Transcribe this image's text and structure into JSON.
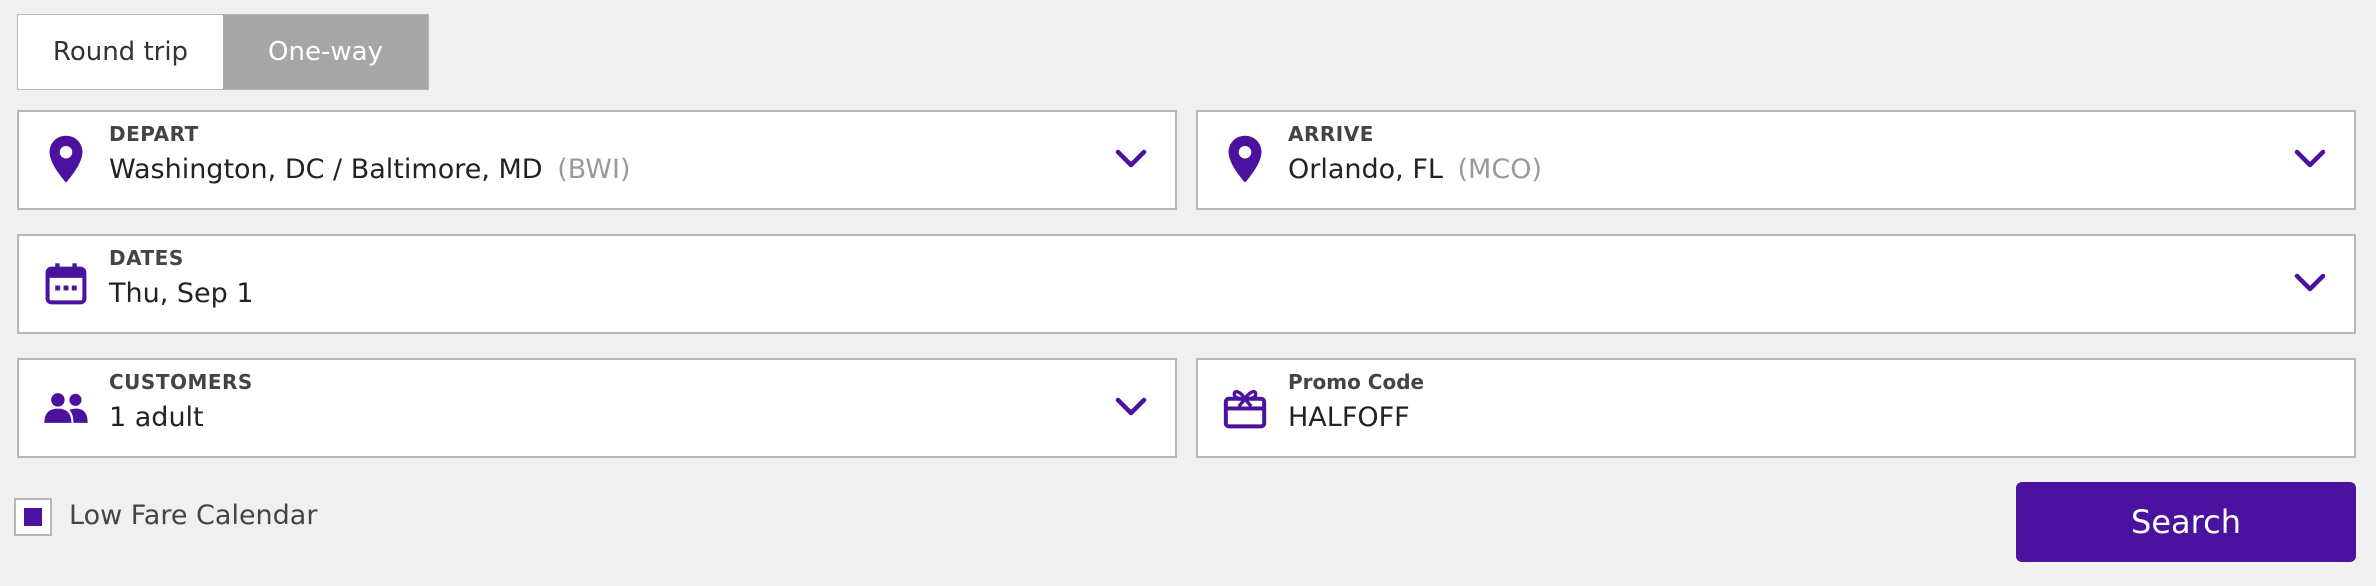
{
  "trip_type": {
    "options": [
      "Round trip",
      "One-way"
    ],
    "selected": "One-way"
  },
  "depart": {
    "label": "DEPART",
    "city": "Washington, DC / Baltimore, MD",
    "code": "(BWI)"
  },
  "arrive": {
    "label": "ARRIVE",
    "city": "Orlando, FL",
    "code": "(MCO)"
  },
  "dates": {
    "label": "DATES",
    "value": "Thu, Sep 1"
  },
  "customers": {
    "label": "CUSTOMERS",
    "value": "1 adult"
  },
  "promo": {
    "label": "Promo Code",
    "value": "HALFOFF"
  },
  "low_fare_calendar": {
    "label": "Low Fare Calendar",
    "checked": true
  },
  "search": {
    "label": "Search"
  },
  "colors": {
    "accent": "#4b12a0",
    "toggle_active": "#a6a6a6",
    "background": "#f0f0f0"
  },
  "icons": [
    "location-pin-icon",
    "calendar-icon",
    "people-icon",
    "gift-card-icon",
    "chevron-down-icon"
  ]
}
